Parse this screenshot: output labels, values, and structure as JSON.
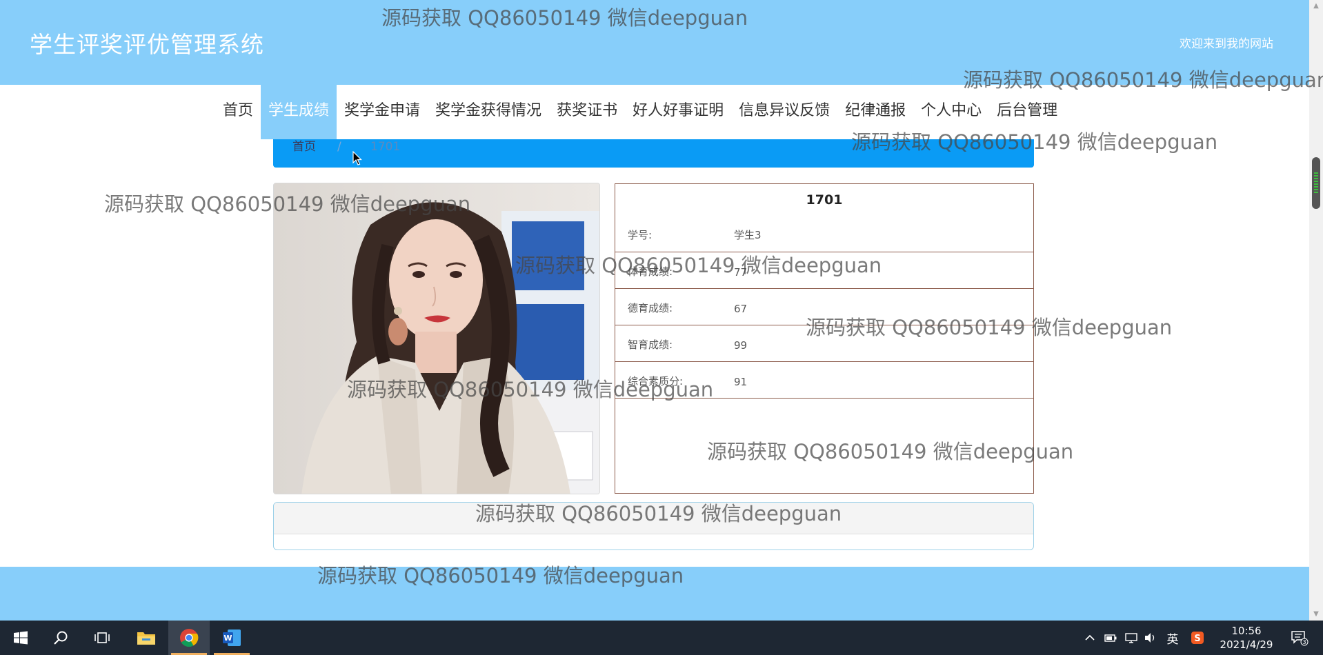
{
  "header": {
    "site_title": "学生评奖评优管理系统",
    "welcome": "欢迎来到我的网站"
  },
  "nav": {
    "items": [
      {
        "label": "首页"
      },
      {
        "label": "学生成绩",
        "active": true
      },
      {
        "label": "奖学金申请"
      },
      {
        "label": "奖学金获得情况"
      },
      {
        "label": "获奖证书"
      },
      {
        "label": "好人好事证明"
      },
      {
        "label": "信息异议反馈"
      },
      {
        "label": "纪律通报"
      },
      {
        "label": "个人中心"
      },
      {
        "label": "后台管理"
      }
    ]
  },
  "breadcrumb": {
    "home": "首页",
    "separator": "/",
    "current": "1701"
  },
  "detail": {
    "title": "1701",
    "fields": [
      {
        "label": "学号:",
        "value": "学生3"
      },
      {
        "label": "体育成绩:",
        "value": "77"
      },
      {
        "label": "德育成绩:",
        "value": "67"
      },
      {
        "label": "智育成绩:",
        "value": "99"
      },
      {
        "label": "综合素质分:",
        "value": "91"
      }
    ]
  },
  "watermark": "源码获取 QQ86050149 微信deepguan",
  "taskbar": {
    "ime": "英",
    "time": "10:56",
    "date": "2021/4/29",
    "notifications": "3"
  },
  "colors": {
    "header_bg": "#87cefa",
    "breadcrumb_bg": "#0a9bf5",
    "detail_border": "#8b5a4a",
    "taskbar_bg": "#1e2733"
  }
}
